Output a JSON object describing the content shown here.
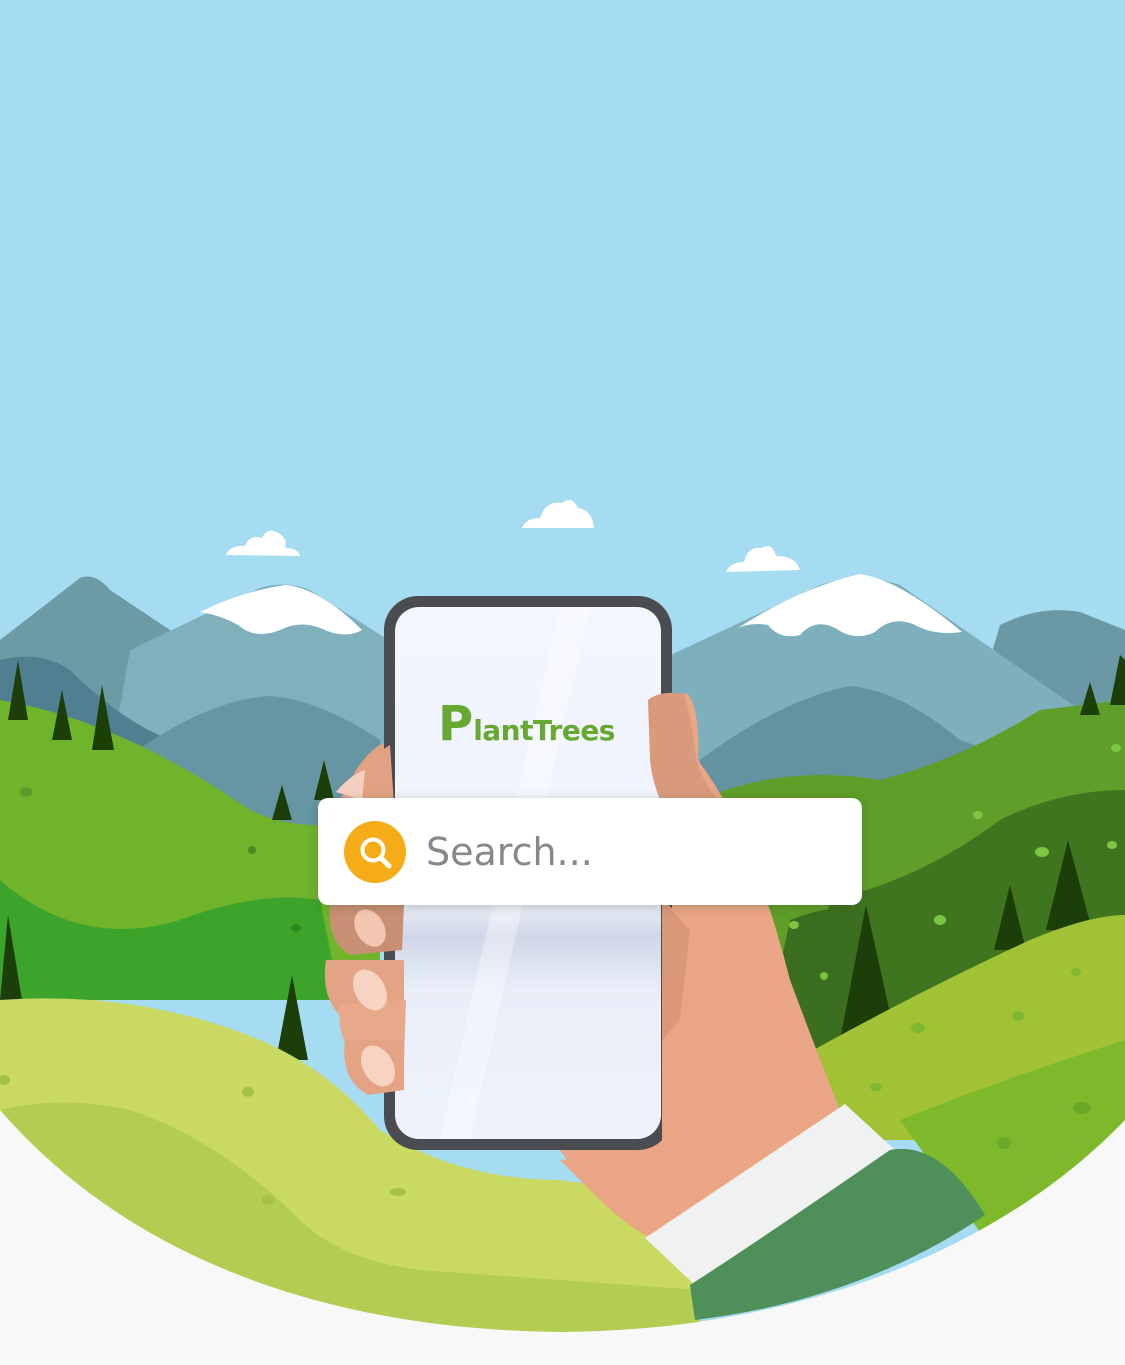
{
  "app": {
    "logo_initial": "P",
    "logo_rest": "lantTrees"
  },
  "search": {
    "placeholder": "Search..."
  },
  "icons": {
    "search": "magnifier-icon"
  },
  "colors": {
    "sky": "#a6dcf2",
    "brand_green": "#67a832",
    "search_accent": "#f5ac17"
  }
}
